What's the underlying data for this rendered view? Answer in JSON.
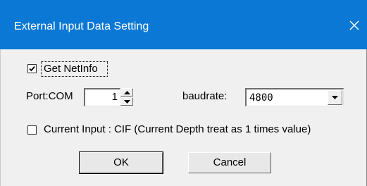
{
  "window": {
    "title": "External Input Data Setting",
    "close_icon": "close-icon"
  },
  "get_netinfo": {
    "label": "Get NetInfo",
    "checked": true
  },
  "port": {
    "label": "Port:COM",
    "value": "1"
  },
  "baudrate": {
    "label": "baudrate:",
    "value": "4800"
  },
  "current_input": {
    "label": "Current Input : CIF (Current Depth treat as 1 times value)",
    "checked": false
  },
  "buttons": {
    "ok": "OK",
    "cancel": "Cancel"
  },
  "colors": {
    "titlebar": "#0a78d4",
    "dialog_bg": "#f0f0f0"
  }
}
